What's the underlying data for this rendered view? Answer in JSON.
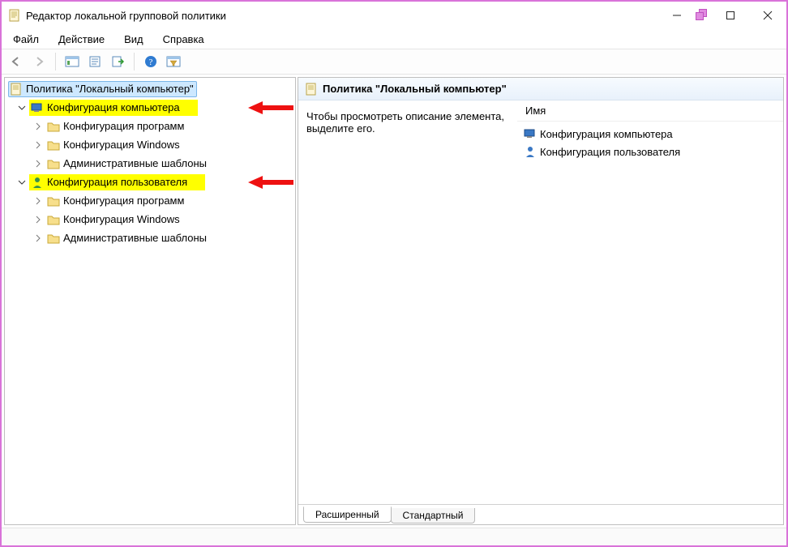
{
  "window": {
    "title": "Редактор локальной групповой политики"
  },
  "menu": {
    "file": "Файл",
    "action": "Действие",
    "view": "Вид",
    "help": "Справка"
  },
  "tree": {
    "root": "Политика \"Локальный компьютер\"",
    "computer_cfg": "Конфигурация компьютера",
    "user_cfg": "Конфигурация пользователя",
    "children": {
      "programs": "Конфигурация программ",
      "windows": "Конфигурация Windows",
      "admin_templates": "Административные шаблоны"
    }
  },
  "content": {
    "header": "Политика \"Локальный компьютер\"",
    "description": "Чтобы просмотреть описание элемента, выделите его.",
    "column_name": "Имя",
    "items": {
      "computer": "Конфигурация компьютера",
      "user": "Конфигурация пользователя"
    }
  },
  "tabs": {
    "extended": "Расширенный",
    "standard": "Стандартный"
  }
}
